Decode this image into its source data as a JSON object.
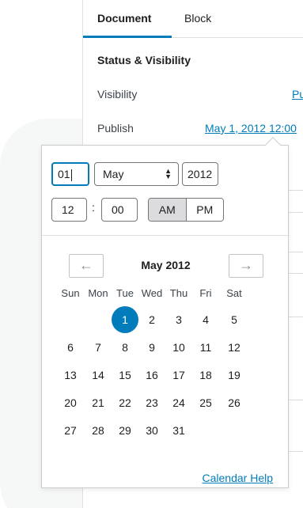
{
  "sidebar": {
    "tabs": [
      {
        "label": "Document",
        "active": true
      },
      {
        "label": "Block",
        "active": false
      }
    ],
    "section_title": "Status & Visibility",
    "visibility": {
      "label": "Visibility",
      "value": "Pu"
    },
    "publish": {
      "label": "Publish",
      "value": "May 1, 2012 12:00"
    }
  },
  "datetime": {
    "day": "01",
    "month": "May",
    "year": "2012",
    "hour": "12",
    "minute": "00",
    "colon": ":",
    "am_label": "AM",
    "pm_label": "PM",
    "meridiem_selected": "AM"
  },
  "calendar": {
    "prev_glyph": "←",
    "next_glyph": "→",
    "month_title": "May 2012",
    "weekdays": [
      "Sun",
      "Mon",
      "Tue",
      "Wed",
      "Thu",
      "Fri",
      "Sat"
    ],
    "first_weekday_index": 2,
    "days": [
      "1",
      "2",
      "3",
      "4",
      "5",
      "6",
      "7",
      "8",
      "9",
      "10",
      "11",
      "12",
      "13",
      "14",
      "15",
      "16",
      "17",
      "18",
      "19",
      "20",
      "21",
      "22",
      "23",
      "24",
      "25",
      "26",
      "27",
      "28",
      "29",
      "30",
      "31"
    ],
    "selected_day": "1",
    "help_link": "Calendar Help"
  },
  "colors": {
    "accent": "#007cba",
    "selected_text": "#ffffff"
  }
}
